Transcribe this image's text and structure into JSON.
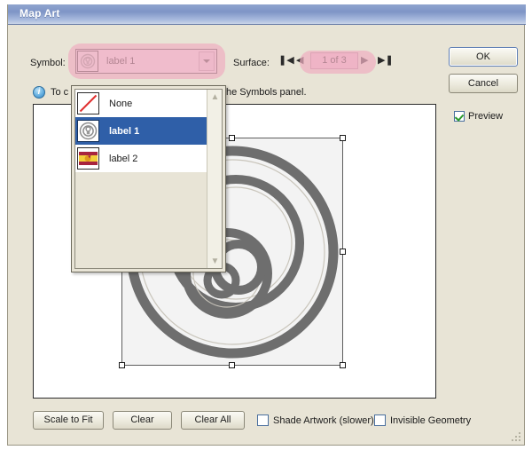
{
  "window": {
    "title": "Map Art"
  },
  "symbol_row": {
    "label": "Symbol:",
    "selected_value": "label 1",
    "thumb_icon": "circular-symbol-icon",
    "arrow_icon": "chevron-down-icon"
  },
  "surface_row": {
    "label": "Surface:",
    "value": "1 of 3",
    "first_icon": "❚◀",
    "prev_icon": "◀",
    "next_icon": "▶",
    "last_icon": "▶❚"
  },
  "info": {
    "icon": "info-icon",
    "icon_glyph": "i",
    "text_before": "To c",
    "text_after": "he Symbols panel."
  },
  "dropdown": {
    "open": true,
    "items": [
      {
        "label": "None",
        "icon": "none-slash-icon",
        "selected": false
      },
      {
        "label": "label 1",
        "icon": "circular-symbol-icon",
        "selected": true
      },
      {
        "label": "label 2",
        "icon": "flag-symbol-icon",
        "selected": false
      }
    ],
    "scroll_up_icon": "chevron-up-icon",
    "scroll_down_icon": "chevron-down-icon"
  },
  "preview": {
    "artwork_name": "concentric-spiral-artwork",
    "selection_visible": true
  },
  "buttons": {
    "ok": "OK",
    "cancel": "Cancel",
    "scale_to_fit": "Scale to Fit",
    "clear": "Clear",
    "clear_all": "Clear All"
  },
  "checkboxes": {
    "preview": {
      "label": "Preview",
      "checked": true
    },
    "shade_artwork": {
      "label": "Shade Artwork (slower)",
      "checked": false
    },
    "invisible_geometry": {
      "label": "Invisible Geometry",
      "checked": false
    }
  },
  "colors": {
    "titlebar_blue": "#7e95c6",
    "dialog_bg": "#e8e4d6",
    "highlight_pink": "#efafc0",
    "selection_blue": "#2f5fa8",
    "artwork_gray": "#6e6e6e"
  }
}
